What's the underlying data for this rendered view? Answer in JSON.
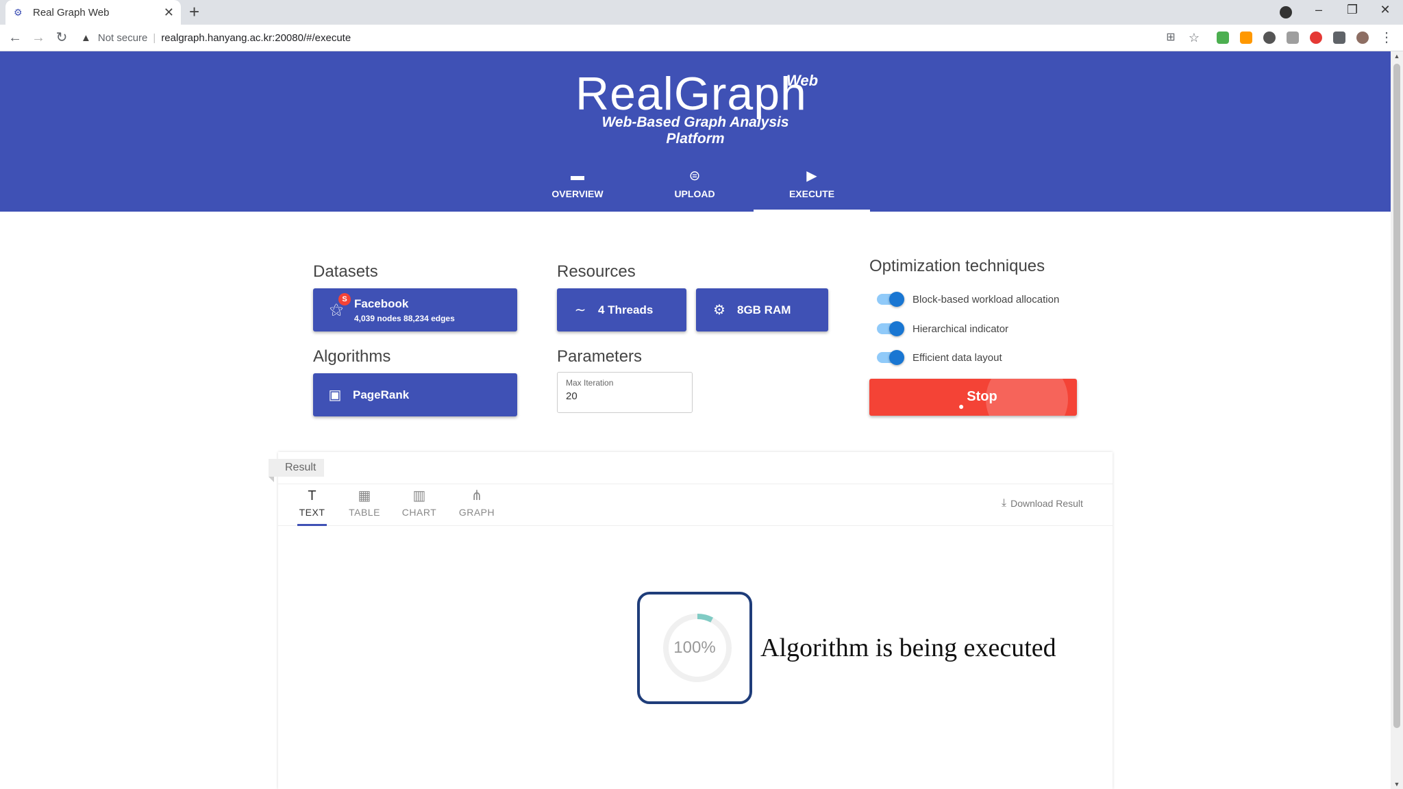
{
  "browser": {
    "tab_title": "Real Graph Web",
    "tab_close": "✕",
    "new_tab": "+",
    "security_label": "Not secure",
    "url": "realgraph.hanyang.ac.kr:20080/#/execute",
    "window_controls": [
      "–",
      "❐",
      "✕"
    ]
  },
  "header": {
    "logo": "RealGraph",
    "logo_sup": "Web",
    "tagline": "Web-Based Graph Analysis Platform",
    "nav": [
      {
        "label": "OVERVIEW",
        "icon": "book-icon",
        "glyph": "▬"
      },
      {
        "label": "UPLOAD",
        "icon": "paperclip-icon",
        "glyph": "⊜"
      },
      {
        "label": "EXECUTE",
        "icon": "play-icon",
        "glyph": "▶",
        "active": true
      }
    ],
    "bg_color": "#3f51b5"
  },
  "datasets": {
    "title": "Datasets",
    "item": {
      "name": "Facebook",
      "stats": "4,039 nodes 88,234 edges",
      "badge": "S",
      "icon": "graph-icon"
    }
  },
  "resources": {
    "title": "Resources",
    "threads": "4 Threads",
    "ram": "8GB RAM"
  },
  "algorithms": {
    "title": "Algorithms",
    "item": "PageRank"
  },
  "parameters": {
    "title": "Parameters",
    "field_label": "Max Iteration",
    "field_value": "20"
  },
  "optimization": {
    "title": "Optimization techniques",
    "options": [
      {
        "label": "Block-based workload allocation",
        "enabled": true
      },
      {
        "label": "Hierarchical indicator",
        "enabled": true
      },
      {
        "label": "Efficient data layout",
        "enabled": true
      }
    ]
  },
  "stop_button": {
    "label": "Stop",
    "color": "#f44336"
  },
  "result": {
    "tag": "Result",
    "tabs": [
      {
        "label": "TEXT",
        "icon": "text-icon",
        "glyph": "T",
        "active": true
      },
      {
        "label": "TABLE",
        "icon": "table-icon",
        "glyph": "▦"
      },
      {
        "label": "CHART",
        "icon": "bar-chart-icon",
        "glyph": "▥"
      },
      {
        "label": "GRAPH",
        "icon": "graph-icon",
        "glyph": "⋔"
      }
    ],
    "download": "Download Result",
    "progress": {
      "value_text": "100%",
      "fraction": 1.0
    },
    "message": "Algorithm is being executed"
  }
}
